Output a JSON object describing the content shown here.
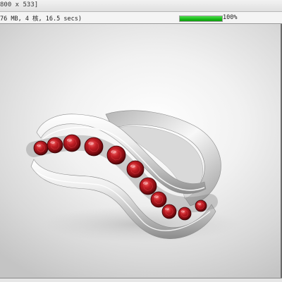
{
  "window": {
    "title": "800 x 533]"
  },
  "status": {
    "render_info": "76 MB, 4 核, 16.5 secs)",
    "progress_percent": 100,
    "progress_label": "100%",
    "progress_color": "#18b818"
  },
  "render": {
    "subject": "silver ring with channel-set red gemstones",
    "metal_color": "#e9e9e9",
    "gem_color": "#b3161c",
    "background_color": "#eeeeee"
  }
}
